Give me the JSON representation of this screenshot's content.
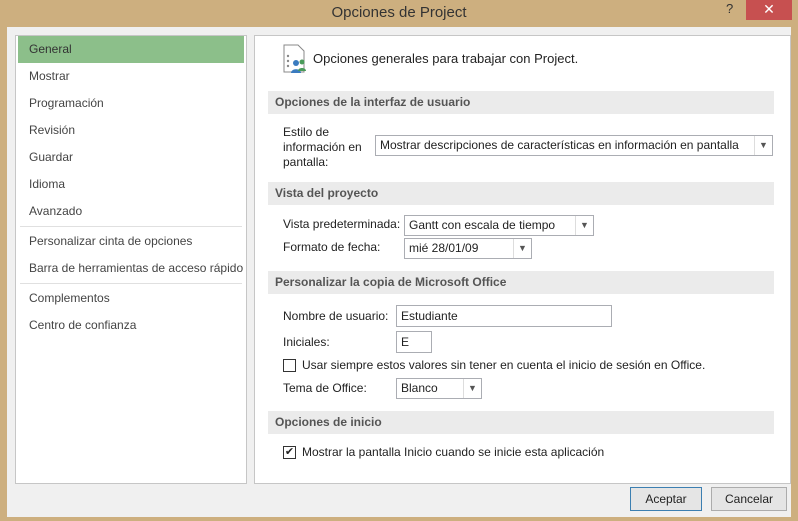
{
  "window": {
    "title": "Opciones de Project",
    "help": "?",
    "close": "✕"
  },
  "sidebar": {
    "items": [
      {
        "label": "General"
      },
      {
        "label": "Mostrar"
      },
      {
        "label": "Programación"
      },
      {
        "label": "Revisión"
      },
      {
        "label": "Guardar"
      },
      {
        "label": "Idioma"
      },
      {
        "label": "Avanzado"
      },
      {
        "label": "Personalizar cinta de opciones"
      },
      {
        "label": "Barra de herramientas de acceso rápido"
      },
      {
        "label": "Complementos"
      },
      {
        "label": "Centro de confianza"
      }
    ]
  },
  "main": {
    "intro": "Opciones generales para trabajar con Project.",
    "ui_section": {
      "title": "Opciones de la interfaz de usuario",
      "tooltip_label": "Estilo de información en pantalla:",
      "tooltip_value": "Mostrar descripciones de características en información en pantalla"
    },
    "view_section": {
      "title": "Vista del proyecto",
      "default_view_label": "Vista predeterminada:",
      "default_view_value": "Gantt con escala de tiempo",
      "date_format_label": "Formato de fecha:",
      "date_format_value": "mié 28/01/09"
    },
    "office_section": {
      "title": "Personalizar la copia de Microsoft Office",
      "username_label": "Nombre de usuario:",
      "username_value": "Estudiante",
      "initials_label": "Iniciales:",
      "initials_value": "E",
      "always_use_label": "Usar siempre estos valores sin tener en cuenta el inicio de sesión en Office.",
      "always_use_checked": false,
      "theme_label": "Tema de Office:",
      "theme_value": "Blanco"
    },
    "start_section": {
      "title": "Opciones de inicio",
      "show_start_label": "Mostrar la pantalla Inicio cuando se inicie esta aplicación",
      "show_start_checked": true
    }
  },
  "buttons": {
    "ok": "Aceptar",
    "cancel": "Cancelar"
  }
}
